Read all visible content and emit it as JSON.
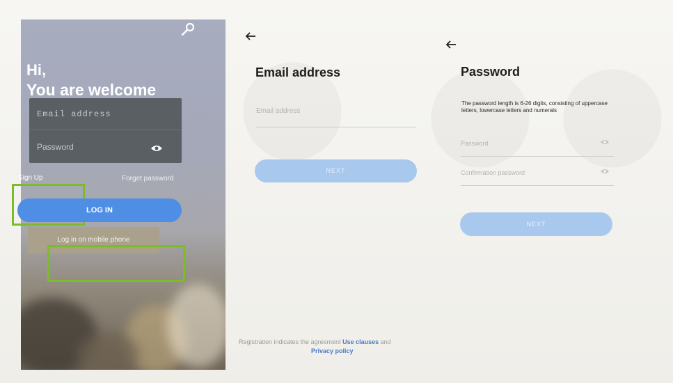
{
  "login": {
    "greeting_line1": "Hi,",
    "greeting_line2": "You are welcome",
    "email_placeholder": "Email address",
    "password_placeholder": "Password",
    "signup_label": "Sign Up",
    "forget_label": "Forget password",
    "login_button": "LOG IN",
    "mobile_login_button": "Log in on mobile phone"
  },
  "email_screen": {
    "title": "Email address",
    "email_placeholder": "Email address",
    "next_button": "NEXT",
    "agreement_text": "Registration indicates the agreement",
    "use_clauses_link": "Use clauses",
    "and_text": "and",
    "privacy_link": "Privacy policy"
  },
  "password_screen": {
    "title": "Password",
    "hint": "The password length is 6-26 digits, consisting of uppercase letters, lowercase letters and numerals",
    "password_placeholder": "Password",
    "confirm_placeholder": "Confirmation password",
    "next_button": "NEXT"
  },
  "colors": {
    "highlight": "#7cbc2a",
    "primary_button": "#4e8ee5",
    "disabled_button": "#a9c8ee",
    "link": "#4b79c6"
  },
  "icons": [
    "settings-icon",
    "eye-icon",
    "back-arrow-icon"
  ]
}
